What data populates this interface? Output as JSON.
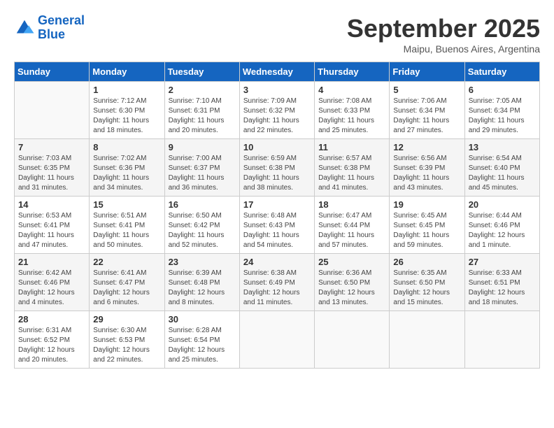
{
  "header": {
    "logo_line1": "General",
    "logo_line2": "Blue",
    "month": "September 2025",
    "location": "Maipu, Buenos Aires, Argentina"
  },
  "weekdays": [
    "Sunday",
    "Monday",
    "Tuesday",
    "Wednesday",
    "Thursday",
    "Friday",
    "Saturday"
  ],
  "weeks": [
    [
      {
        "day": "",
        "info": ""
      },
      {
        "day": "1",
        "info": "Sunrise: 7:12 AM\nSunset: 6:30 PM\nDaylight: 11 hours\nand 18 minutes."
      },
      {
        "day": "2",
        "info": "Sunrise: 7:10 AM\nSunset: 6:31 PM\nDaylight: 11 hours\nand 20 minutes."
      },
      {
        "day": "3",
        "info": "Sunrise: 7:09 AM\nSunset: 6:32 PM\nDaylight: 11 hours\nand 22 minutes."
      },
      {
        "day": "4",
        "info": "Sunrise: 7:08 AM\nSunset: 6:33 PM\nDaylight: 11 hours\nand 25 minutes."
      },
      {
        "day": "5",
        "info": "Sunrise: 7:06 AM\nSunset: 6:34 PM\nDaylight: 11 hours\nand 27 minutes."
      },
      {
        "day": "6",
        "info": "Sunrise: 7:05 AM\nSunset: 6:34 PM\nDaylight: 11 hours\nand 29 minutes."
      }
    ],
    [
      {
        "day": "7",
        "info": "Sunrise: 7:03 AM\nSunset: 6:35 PM\nDaylight: 11 hours\nand 31 minutes."
      },
      {
        "day": "8",
        "info": "Sunrise: 7:02 AM\nSunset: 6:36 PM\nDaylight: 11 hours\nand 34 minutes."
      },
      {
        "day": "9",
        "info": "Sunrise: 7:00 AM\nSunset: 6:37 PM\nDaylight: 11 hours\nand 36 minutes."
      },
      {
        "day": "10",
        "info": "Sunrise: 6:59 AM\nSunset: 6:38 PM\nDaylight: 11 hours\nand 38 minutes."
      },
      {
        "day": "11",
        "info": "Sunrise: 6:57 AM\nSunset: 6:38 PM\nDaylight: 11 hours\nand 41 minutes."
      },
      {
        "day": "12",
        "info": "Sunrise: 6:56 AM\nSunset: 6:39 PM\nDaylight: 11 hours\nand 43 minutes."
      },
      {
        "day": "13",
        "info": "Sunrise: 6:54 AM\nSunset: 6:40 PM\nDaylight: 11 hours\nand 45 minutes."
      }
    ],
    [
      {
        "day": "14",
        "info": "Sunrise: 6:53 AM\nSunset: 6:41 PM\nDaylight: 11 hours\nand 47 minutes."
      },
      {
        "day": "15",
        "info": "Sunrise: 6:51 AM\nSunset: 6:41 PM\nDaylight: 11 hours\nand 50 minutes."
      },
      {
        "day": "16",
        "info": "Sunrise: 6:50 AM\nSunset: 6:42 PM\nDaylight: 11 hours\nand 52 minutes."
      },
      {
        "day": "17",
        "info": "Sunrise: 6:48 AM\nSunset: 6:43 PM\nDaylight: 11 hours\nand 54 minutes."
      },
      {
        "day": "18",
        "info": "Sunrise: 6:47 AM\nSunset: 6:44 PM\nDaylight: 11 hours\nand 57 minutes."
      },
      {
        "day": "19",
        "info": "Sunrise: 6:45 AM\nSunset: 6:45 PM\nDaylight: 11 hours\nand 59 minutes."
      },
      {
        "day": "20",
        "info": "Sunrise: 6:44 AM\nSunset: 6:46 PM\nDaylight: 12 hours\nand 1 minute."
      }
    ],
    [
      {
        "day": "21",
        "info": "Sunrise: 6:42 AM\nSunset: 6:46 PM\nDaylight: 12 hours\nand 4 minutes."
      },
      {
        "day": "22",
        "info": "Sunrise: 6:41 AM\nSunset: 6:47 PM\nDaylight: 12 hours\nand 6 minutes."
      },
      {
        "day": "23",
        "info": "Sunrise: 6:39 AM\nSunset: 6:48 PM\nDaylight: 12 hours\nand 8 minutes."
      },
      {
        "day": "24",
        "info": "Sunrise: 6:38 AM\nSunset: 6:49 PM\nDaylight: 12 hours\nand 11 minutes."
      },
      {
        "day": "25",
        "info": "Sunrise: 6:36 AM\nSunset: 6:50 PM\nDaylight: 12 hours\nand 13 minutes."
      },
      {
        "day": "26",
        "info": "Sunrise: 6:35 AM\nSunset: 6:50 PM\nDaylight: 12 hours\nand 15 minutes."
      },
      {
        "day": "27",
        "info": "Sunrise: 6:33 AM\nSunset: 6:51 PM\nDaylight: 12 hours\nand 18 minutes."
      }
    ],
    [
      {
        "day": "28",
        "info": "Sunrise: 6:31 AM\nSunset: 6:52 PM\nDaylight: 12 hours\nand 20 minutes."
      },
      {
        "day": "29",
        "info": "Sunrise: 6:30 AM\nSunset: 6:53 PM\nDaylight: 12 hours\nand 22 minutes."
      },
      {
        "day": "30",
        "info": "Sunrise: 6:28 AM\nSunset: 6:54 PM\nDaylight: 12 hours\nand 25 minutes."
      },
      {
        "day": "",
        "info": ""
      },
      {
        "day": "",
        "info": ""
      },
      {
        "day": "",
        "info": ""
      },
      {
        "day": "",
        "info": ""
      }
    ]
  ]
}
